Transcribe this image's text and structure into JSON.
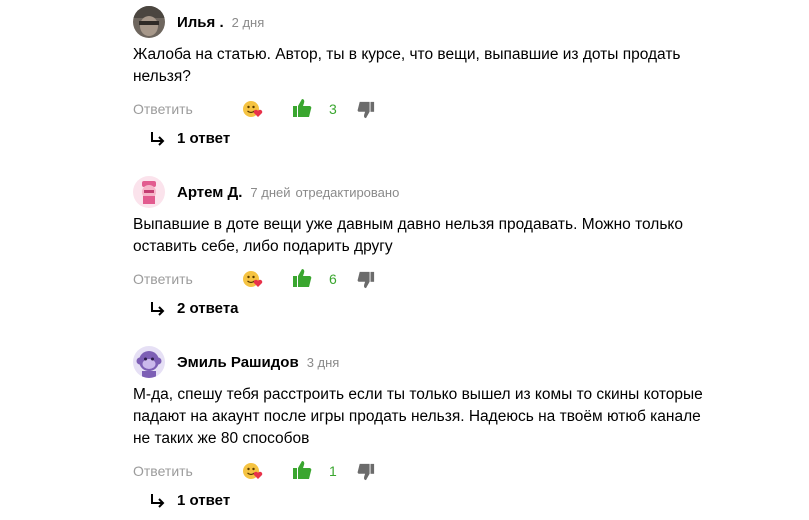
{
  "comments": [
    {
      "author": "Илья .",
      "time": "2 дня",
      "edited": "",
      "text_lines": [
        "Жалоба на статью. Автор, ты в курсе, что вещи, выпавшие из доты продать",
        "нельзя?"
      ],
      "reply_label": "Ответить",
      "likes": "3",
      "replies_label": "1 ответ",
      "avatar_icon": "user-photo-avatar"
    },
    {
      "author": "Артем Д.",
      "time": "7 дней",
      "edited": "отредактировано",
      "text_lines": [
        "Выпавшие в доте вещи уже давным давно нельзя продавать. Можно только",
        "оставить себе, либо подарить другу"
      ],
      "reply_label": "Ответить",
      "likes": "6",
      "replies_label": "2 ответа",
      "avatar_icon": "cartoon-face-avatar"
    },
    {
      "author": "Эмиль Рашидов",
      "time": "3 дня",
      "edited": "",
      "text_lines": [
        "М-да, спешу тебя расстроить если ты только вышел из комы то скины которые",
        "падают на акаунт после игры продать нельзя. Надеюсь на твоём ютюб канале",
        "не таких же 80 способов"
      ],
      "reply_label": "Ответить",
      "likes": "1",
      "replies_label": "1 ответ",
      "avatar_icon": "monkey-avatar"
    }
  ],
  "colors": {
    "like_green": "#3aa62f",
    "muted": "#9b9b9b"
  }
}
